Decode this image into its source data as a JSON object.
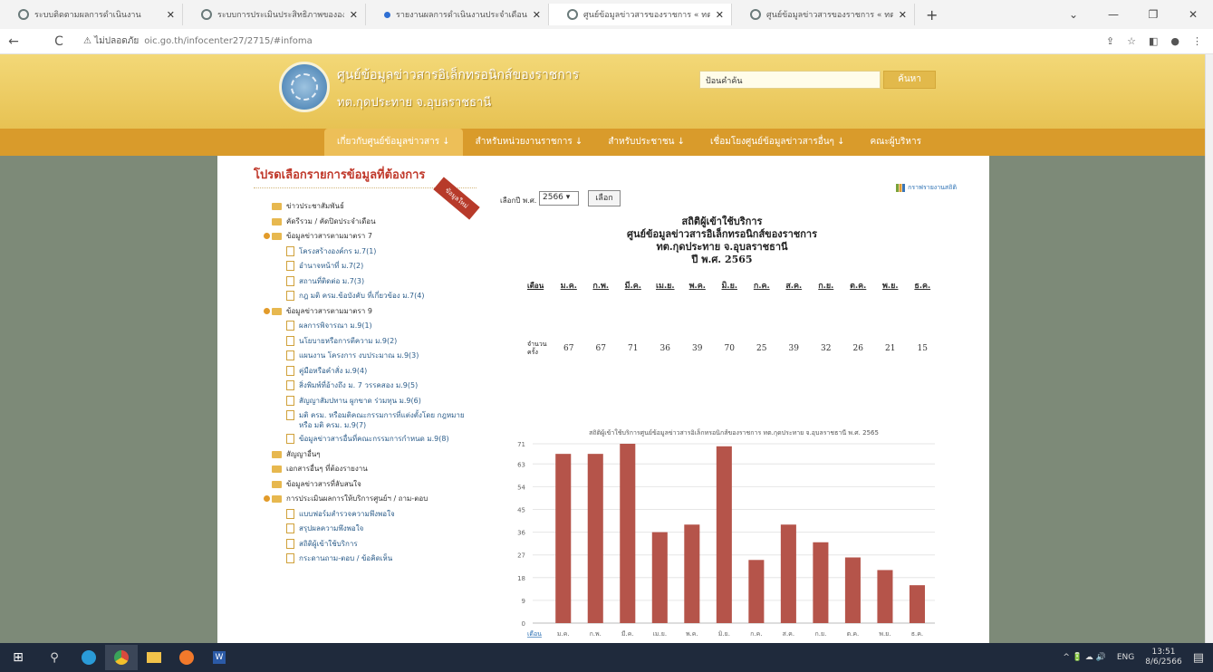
{
  "browser": {
    "tabs": [
      {
        "title": "ระบบติดตามผลการดำเนินงาน",
        "active": false
      },
      {
        "title": "ระบบการประเมินประสิทธิภาพขององค์",
        "active": false
      },
      {
        "title": "รายงานผลการดำเนินงานประจำเดือน",
        "active": false
      },
      {
        "title": "ศูนย์ข้อมูลข่าวสารของราชการ « ทต.",
        "active": true
      },
      {
        "title": "ศูนย์ข้อมูลข่าวสารของราชการ « ทต.",
        "active": false
      }
    ],
    "new_tab": "+",
    "security_label": "ไม่ปลอดภัย",
    "url": "oic.go.th/infocenter27/2715/#infoma",
    "window_controls": [
      "⌄",
      "—",
      "❐",
      "✕"
    ]
  },
  "site": {
    "title": "ศูนย์ข้อมูลข่าวสารอิเล็กทรอนิกส์ของราชการ",
    "subtitle": "ทต.กุดประทาย จ.อุบลราชธานี",
    "search_placeholder": "ป้อนคำค้น",
    "search_button": "ค้นหา"
  },
  "menu": [
    "เกี่ยวกับศูนย์ข้อมูลข่าวสาร ↓",
    "สำหรับหน่วยงานราชการ ↓",
    "สำหรับประชาชน ↓",
    "เชื่อมโยงศูนย์ข้อมูลข่าวสารอื่นๆ ↓",
    "คณะผู้บริหาร"
  ],
  "left_panel": {
    "title": "โปรดเลือกรายการข้อมูลที่ต้องการ",
    "ribbon": "ข้อมูลใหม่",
    "items": [
      {
        "label": "ข่าวประชาสัมพันธ์",
        "kind": "folder"
      },
      {
        "label": "คัดรีรวม / คัดปิดประจำเดือน",
        "kind": "folder"
      },
      {
        "label": "ข้อมูลข่าวสารตามมาตรา 7",
        "kind": "open-folder"
      },
      {
        "label": "โครงสร้างองค์กร ม.7(1)",
        "kind": "doc"
      },
      {
        "label": "อำนาจหน้าที่ ม.7(2)",
        "kind": "doc"
      },
      {
        "label": "สถานที่ติดต่อ ม.7(3)",
        "kind": "doc"
      },
      {
        "label": "กฎ มติ ครม.ข้อบังคับ ที่เกี่ยวข้อง ม.7(4)",
        "kind": "doc"
      },
      {
        "label": "ข้อมูลข่าวสารตามมาตรา 9",
        "kind": "open-folder"
      },
      {
        "label": "ผลการพิจารณา ม.9(1)",
        "kind": "doc"
      },
      {
        "label": "นโยบายหรือการตีความ ม.9(2)",
        "kind": "doc"
      },
      {
        "label": "แผนงาน โครงการ งบประมาณ ม.9(3)",
        "kind": "doc"
      },
      {
        "label": "คู่มือหรือคำสั่ง ม.9(4)",
        "kind": "doc"
      },
      {
        "label": "สิ่งพิมพ์ที่อ้างถึง ม. 7 วรรคสอง ม.9(5)",
        "kind": "doc"
      },
      {
        "label": "สัญญาสัมปทาน ผูกขาด ร่วมทุน ม.9(6)",
        "kind": "doc"
      },
      {
        "label": "มติ ครม. หรือมติคณะกรรมการที่แต่งตั้งโดย กฎหมาย หรือ มติ ครม. ม.9(7)",
        "kind": "doc-tall"
      },
      {
        "label": "ข้อมูลข่าวสารอื่นที่คณะกรรมการกำหนด ม.9(8)",
        "kind": "doc"
      },
      {
        "label": "สัญญาอื่นๆ",
        "kind": "folder"
      },
      {
        "label": "เอกสารอื่นๆ ที่ต้องรายงาน",
        "kind": "folder"
      },
      {
        "label": "ข้อมูลข่าวสารที่ลับสนใจ",
        "kind": "folder"
      },
      {
        "label": "การประเมินผลการให้บริการศูนย์ฯ / ถาม-ตอบ",
        "kind": "open-folder"
      },
      {
        "label": "แบบฟอร์มสำรวจความพึงพอใจ",
        "kind": "doc"
      },
      {
        "label": "สรุปผลความพึงพอใจ",
        "kind": "doc"
      },
      {
        "label": "สถิติผู้เข้าใช้บริการ",
        "kind": "doc"
      },
      {
        "label": "กระดานถาม-ตอบ / ข้อคิดเห็น",
        "kind": "doc"
      }
    ]
  },
  "stats": {
    "year_label": "เลือกปี พ.ศ.",
    "year_value": "2566",
    "year_button": "เลือก",
    "graph_link": "กราฟรายงานสถิติ",
    "title_lines": [
      "สถิติผู้เข้าใช้บริการ",
      "ศูนย์ข้อมูลข่าวสารอิเล็กทรอนิกส์ของราชการ",
      "ทต.กุดประทาย จ.อุบลราชธานี",
      "ปี พ.ศ. 2565"
    ],
    "month_header": "เดือน",
    "count_header": "จำนวน ครั้ง"
  },
  "chart_data": {
    "type": "bar",
    "title": "สถิติผู้เข้าใช้บริการศูนย์ข้อมูลข่าวสารอิเล็กทรอนิกส์ของราชการ ทต.กุดประทาย จ.อุบลราชธานี พ.ศ. 2565",
    "xlabel": "เดือน",
    "categories": [
      "ม.ค.",
      "ก.พ.",
      "มี.ค.",
      "เม.ย.",
      "พ.ค.",
      "มิ.ย.",
      "ก.ค.",
      "ส.ค.",
      "ก.ย.",
      "ต.ค.",
      "พ.ย.",
      "ธ.ค."
    ],
    "values": [
      67,
      67,
      71,
      36,
      39,
      70,
      25,
      39,
      32,
      26,
      21,
      15
    ],
    "yticks": [
      0,
      9,
      18,
      27,
      36,
      45,
      54,
      63,
      71
    ],
    "ylim": [
      0,
      71
    ],
    "bar_color": "#b5544a",
    "grid": true
  },
  "taskbar": {
    "tray_lang": "ENG",
    "time": "13:51",
    "date": "8/6/2566",
    "tray_icons": "^ 🔋 ☁ 🔊"
  }
}
